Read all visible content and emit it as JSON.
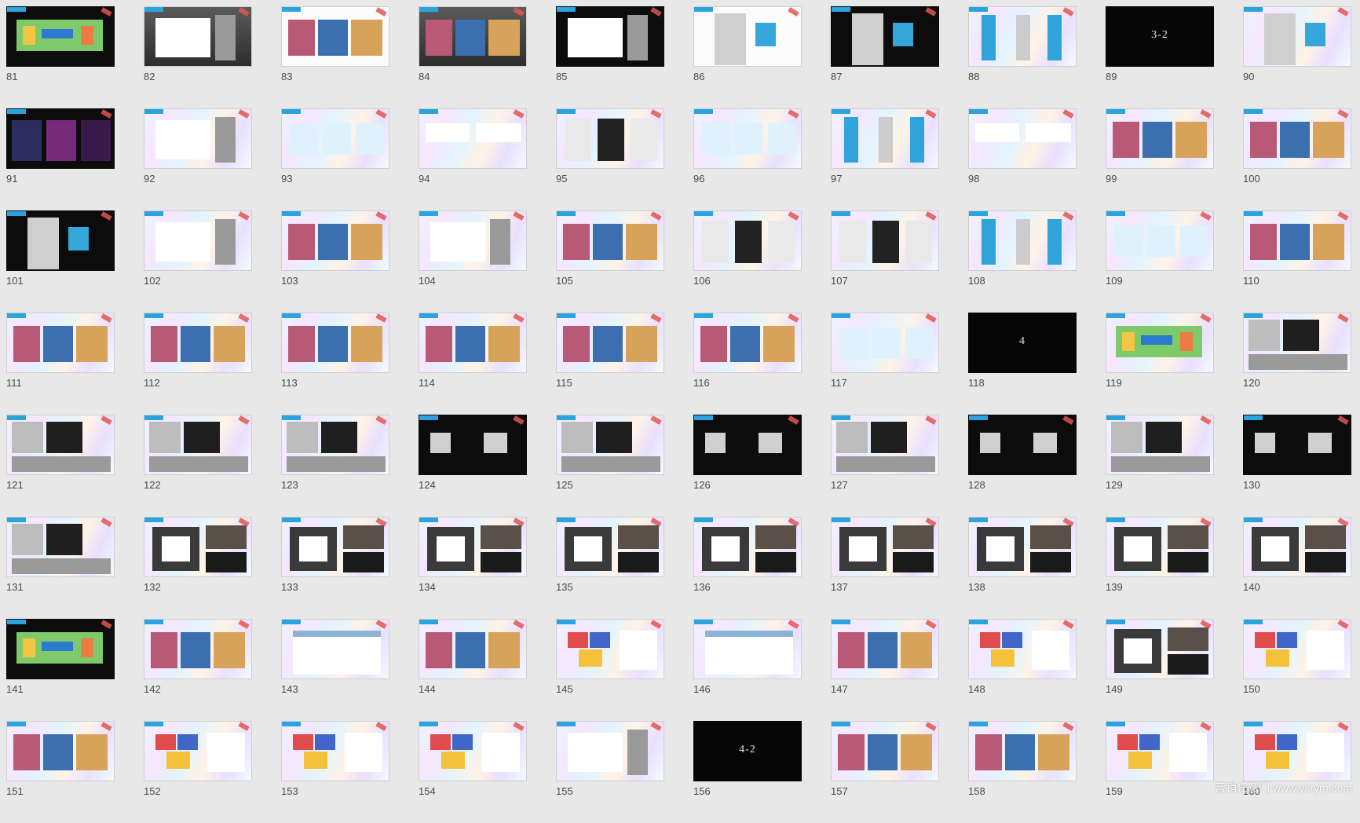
{
  "grid": {
    "slides": [
      {
        "number": "81",
        "style": "dark",
        "thumb": "plan"
      },
      {
        "number": "82",
        "style": "gray",
        "thumb": "doc"
      },
      {
        "number": "83",
        "style": "white",
        "thumb": "photos"
      },
      {
        "number": "84",
        "style": "gray",
        "thumb": "photos"
      },
      {
        "number": "85",
        "style": "dark",
        "thumb": "doc"
      },
      {
        "number": "86",
        "style": "white",
        "thumb": "person"
      },
      {
        "number": "87",
        "style": "dark",
        "thumb": "person"
      },
      {
        "number": "88",
        "style": "light",
        "thumb": "stands"
      },
      {
        "number": "89",
        "style": "title",
        "thumb": "title",
        "title": "3-2"
      },
      {
        "number": "90",
        "style": "light",
        "thumb": "person"
      },
      {
        "number": "91",
        "style": "dark",
        "thumb": "neon"
      },
      {
        "number": "92",
        "style": "light",
        "thumb": "doc"
      },
      {
        "number": "93",
        "style": "light",
        "thumb": "cards"
      },
      {
        "number": "94",
        "style": "light",
        "thumb": "signs"
      },
      {
        "number": "95",
        "style": "light",
        "thumb": "shirts"
      },
      {
        "number": "96",
        "style": "light",
        "thumb": "cards"
      },
      {
        "number": "97",
        "style": "light",
        "thumb": "stands"
      },
      {
        "number": "98",
        "style": "light",
        "thumb": "signs"
      },
      {
        "number": "99",
        "style": "light",
        "thumb": "photos"
      },
      {
        "number": "100",
        "style": "light",
        "thumb": "photos"
      },
      {
        "number": "101",
        "style": "dark",
        "thumb": "person"
      },
      {
        "number": "102",
        "style": "light",
        "thumb": "doc"
      },
      {
        "number": "103",
        "style": "light",
        "thumb": "photos"
      },
      {
        "number": "104",
        "style": "light",
        "thumb": "doc"
      },
      {
        "number": "105",
        "style": "light",
        "thumb": "photos"
      },
      {
        "number": "106",
        "style": "light",
        "thumb": "shirts"
      },
      {
        "number": "107",
        "style": "light",
        "thumb": "shirts"
      },
      {
        "number": "108",
        "style": "light",
        "thumb": "stands"
      },
      {
        "number": "109",
        "style": "light",
        "thumb": "cards"
      },
      {
        "number": "110",
        "style": "light",
        "thumb": "photos"
      },
      {
        "number": "111",
        "style": "light",
        "thumb": "photos"
      },
      {
        "number": "112",
        "style": "light",
        "thumb": "photos"
      },
      {
        "number": "113",
        "style": "light",
        "thumb": "photos"
      },
      {
        "number": "114",
        "style": "light",
        "thumb": "photos"
      },
      {
        "number": "115",
        "style": "light",
        "thumb": "photos"
      },
      {
        "number": "116",
        "style": "light",
        "thumb": "photos"
      },
      {
        "number": "117",
        "style": "light",
        "thumb": "cards"
      },
      {
        "number": "118",
        "style": "title",
        "thumb": "title",
        "title": "4"
      },
      {
        "number": "119",
        "style": "light",
        "thumb": "plan"
      },
      {
        "number": "120",
        "style": "light",
        "thumb": "rooms"
      },
      {
        "number": "121",
        "style": "light",
        "thumb": "rooms"
      },
      {
        "number": "122",
        "style": "light",
        "thumb": "rooms"
      },
      {
        "number": "123",
        "style": "light",
        "thumb": "rooms"
      },
      {
        "number": "124",
        "style": "dark",
        "thumb": "boxes"
      },
      {
        "number": "125",
        "style": "light",
        "thumb": "rooms"
      },
      {
        "number": "126",
        "style": "dark",
        "thumb": "boxes"
      },
      {
        "number": "127",
        "style": "light",
        "thumb": "rooms"
      },
      {
        "number": "128",
        "style": "dark",
        "thumb": "boxes"
      },
      {
        "number": "129",
        "style": "light",
        "thumb": "rooms"
      },
      {
        "number": "130",
        "style": "dark",
        "thumb": "boxes"
      },
      {
        "number": "131",
        "style": "light",
        "thumb": "rooms"
      },
      {
        "number": "132",
        "style": "light",
        "thumb": "arena"
      },
      {
        "number": "133",
        "style": "light",
        "thumb": "arena"
      },
      {
        "number": "134",
        "style": "light",
        "thumb": "arena"
      },
      {
        "number": "135",
        "style": "light",
        "thumb": "arena"
      },
      {
        "number": "136",
        "style": "light",
        "thumb": "arena"
      },
      {
        "number": "137",
        "style": "light",
        "thumb": "arena"
      },
      {
        "number": "138",
        "style": "light",
        "thumb": "arena"
      },
      {
        "number": "139",
        "style": "light",
        "thumb": "arena"
      },
      {
        "number": "140",
        "style": "light",
        "thumb": "arena"
      },
      {
        "number": "141",
        "style": "dark",
        "thumb": "plan"
      },
      {
        "number": "142",
        "style": "light",
        "thumb": "photos"
      },
      {
        "number": "143",
        "style": "light",
        "thumb": "table"
      },
      {
        "number": "144",
        "style": "light",
        "thumb": "photos"
      },
      {
        "number": "145",
        "style": "light",
        "thumb": "seating"
      },
      {
        "number": "146",
        "style": "light",
        "thumb": "table"
      },
      {
        "number": "147",
        "style": "light",
        "thumb": "photos"
      },
      {
        "number": "148",
        "style": "light",
        "thumb": "seating"
      },
      {
        "number": "149",
        "style": "light",
        "thumb": "arena"
      },
      {
        "number": "150",
        "style": "light",
        "thumb": "seating"
      },
      {
        "number": "151",
        "style": "light",
        "thumb": "photos"
      },
      {
        "number": "152",
        "style": "light",
        "thumb": "seating"
      },
      {
        "number": "153",
        "style": "light",
        "thumb": "seating"
      },
      {
        "number": "154",
        "style": "light",
        "thumb": "seating"
      },
      {
        "number": "155",
        "style": "light",
        "thumb": "doc"
      },
      {
        "number": "156",
        "style": "title",
        "thumb": "title",
        "title": "4-2"
      },
      {
        "number": "157",
        "style": "light",
        "thumb": "photos"
      },
      {
        "number": "158",
        "style": "light",
        "thumb": "photos"
      },
      {
        "number": "159",
        "style": "light",
        "thumb": "seating"
      },
      {
        "number": "160",
        "style": "light",
        "thumb": "seating"
      }
    ]
  },
  "watermark": "营销任意门 www.yxrym.com",
  "colors": {
    "accent": "#2aa3df",
    "tag": "#e2564f",
    "background": "#e8e8e8"
  }
}
